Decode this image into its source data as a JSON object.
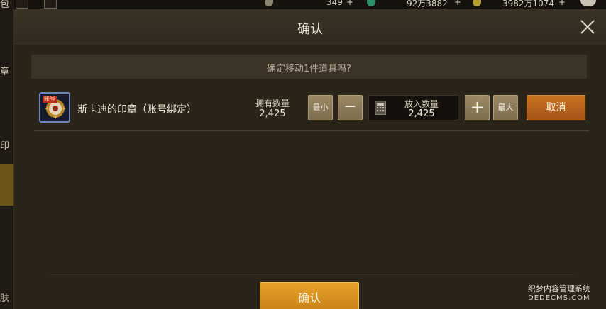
{
  "background": {
    "side_labels": [
      "包",
      "章",
      "印",
      "肤"
    ],
    "resources": [
      {
        "icon": "moon-icon",
        "value": "349"
      },
      {
        "icon": "gem-icon",
        "value": "92万3882"
      },
      {
        "icon": "gold-coin-icon",
        "value": "3982万1074"
      }
    ],
    "add_symbol": "+"
  },
  "dialog": {
    "title": "确认",
    "prompt": "确定移动1件道具吗?",
    "item": {
      "name": "斯卡迪的印章（账号绑定）",
      "icon_badge": "账号",
      "owned_label": "拥有数量",
      "owned_value": "2,425"
    },
    "controls": {
      "min_label": "最小",
      "minus_label": "−",
      "quantity_label": "放入数量",
      "quantity_value": "2,425",
      "plus_label": "+",
      "max_label": "最大",
      "cancel_label": "取消"
    },
    "confirm_label": "确认"
  },
  "watermark": {
    "line1": "织梦内容管理系统",
    "line2": "DEDECMS.COM"
  },
  "colors": {
    "dialog_bg": "#2b2519",
    "cancel_button": "#b8611d",
    "confirm_button": "#d98d1e",
    "beige_button": "#8c7b5a"
  }
}
